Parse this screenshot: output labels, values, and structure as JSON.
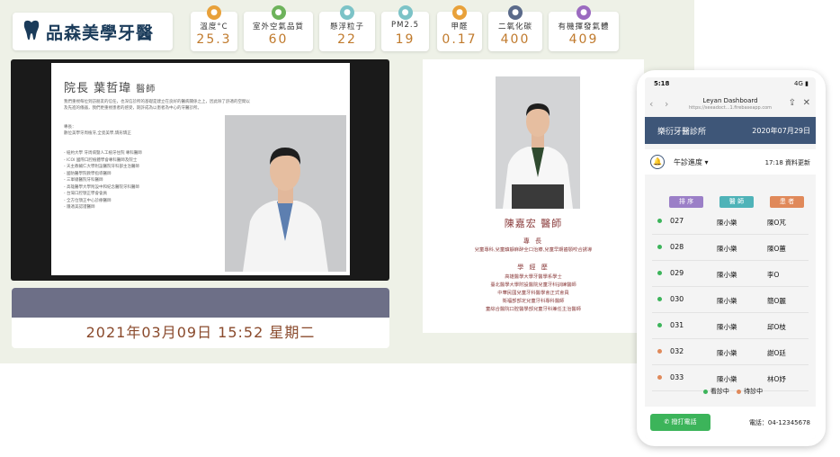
{
  "brand": {
    "name": "品森美學牙醫",
    "icon": "tooth-icon",
    "color": "#1a3b5a"
  },
  "sensors": [
    {
      "label": "溫度°C",
      "value": "25.3",
      "icon": "thermometer-icon",
      "color": "#e8a13a"
    },
    {
      "label": "室外空氣品質",
      "value": "60",
      "icon": "leaf-icon",
      "color": "#6db35b"
    },
    {
      "label": "懸浮粒子",
      "value": "22",
      "icon": "particle-icon",
      "color": "#7cc3c7"
    },
    {
      "label": "PM2.5",
      "value": "19",
      "icon": "pm25-icon",
      "color": "#7cc3c7"
    },
    {
      "label": "甲醛",
      "value": "0.17",
      "icon": "formaldehyde-icon",
      "color": "#e8a13a"
    },
    {
      "label": "二氧化碳",
      "value": "400",
      "icon": "co2-cloud-icon",
      "color": "#5a6a8a"
    },
    {
      "label": "有機揮發氣體",
      "value": "409",
      "icon": "voc-icon",
      "color": "#9b6ac0"
    }
  ],
  "slide": {
    "title": "院長 葉哲瑋",
    "title_suffix": "醫師",
    "intro": "我們重視每位到訪朋友的信任，也深信診所的基礎是建立在良好的醫病關係之上，因此除了舒適的空間以及先進的儀器，我們更重視患者的感受，期許成為以患者為中心的牙醫診所。",
    "specialty_label": "專長：",
    "specialty": "數位美學牙周植牙,全瓷美學,矯形矯正",
    "list": [
      "- 紐約大學 牙周病暨人工植牙住院 專科醫師",
      "- ICOI 國際口腔植體學會專科醫師及院士",
      "- 天主教輔仁大學附設醫院牙科部主治醫師",
      "- 國防醫學院教學指導醫師",
      "- 三軍總醫院牙科醫師",
      "- 高雄醫學大學附設中和紀念醫院牙科醫師",
      "- 台灣口腔顎正學會會員",
      "- 全方位顎正中心診療醫師",
      "- 隱適美認證醫師"
    ]
  },
  "clock": "2021年03月09日 15:52 星期二",
  "doctor": {
    "name": "陳嘉宏 醫師",
    "specialty_heading": "專 長",
    "specialty": "兒童專科,兒童鎮靜麻醉全口治療,兒童早期齒顎咬合誘導",
    "history_heading": "學 經 歷",
    "history": [
      "高雄醫學大學牙醫學系學士",
      "臺北醫學大學附設醫院兒童牙科訓練醫師",
      "中華民國兒童牙科醫學會正式會員",
      "衛福部部定兒童牙科專科醫師",
      "童綜合醫院口腔醫學部兒童牙科兼任主治醫師"
    ]
  },
  "phone": {
    "time": "5:18",
    "signal": "4G",
    "page_title": "Leyan Dashboard",
    "url": "https://seeadoct...1.firebaseapp.com",
    "clinic": "樂衍牙醫診所",
    "date": "2020年07月29日",
    "session": "午診進度",
    "updated": "17:18 資料更新",
    "headers": {
      "order": "排 序",
      "doctor": "醫 師",
      "patient": "患 者"
    },
    "header_colors": {
      "order": "#9b7fc7",
      "doctor": "#4fb3b8",
      "patient": "#e0895a"
    },
    "rows": [
      {
        "num": "027",
        "doctor": "陳小樂",
        "patient": "陳O芃",
        "status": "seeing"
      },
      {
        "num": "028",
        "doctor": "陳小樂",
        "patient": "陳O蕙",
        "status": "seeing"
      },
      {
        "num": "029",
        "doctor": "陳小樂",
        "patient": "李O",
        "status": "seeing"
      },
      {
        "num": "030",
        "doctor": "陳小樂",
        "patient": "簡O麗",
        "status": "seeing"
      },
      {
        "num": "031",
        "doctor": "陳小樂",
        "patient": "邱O枝",
        "status": "seeing"
      },
      {
        "num": "032",
        "doctor": "陳小樂",
        "patient": "謝O廷",
        "status": "waiting"
      },
      {
        "num": "033",
        "doctor": "陳小樂",
        "patient": "林O妤",
        "status": "waiting"
      }
    ],
    "legend_seeing": "看診中",
    "legend_waiting": "待診中",
    "seeing_color": "#3cb45a",
    "waiting_color": "#e0895a",
    "call_button": "撥打電話",
    "tel": "電話：04-12345678"
  }
}
